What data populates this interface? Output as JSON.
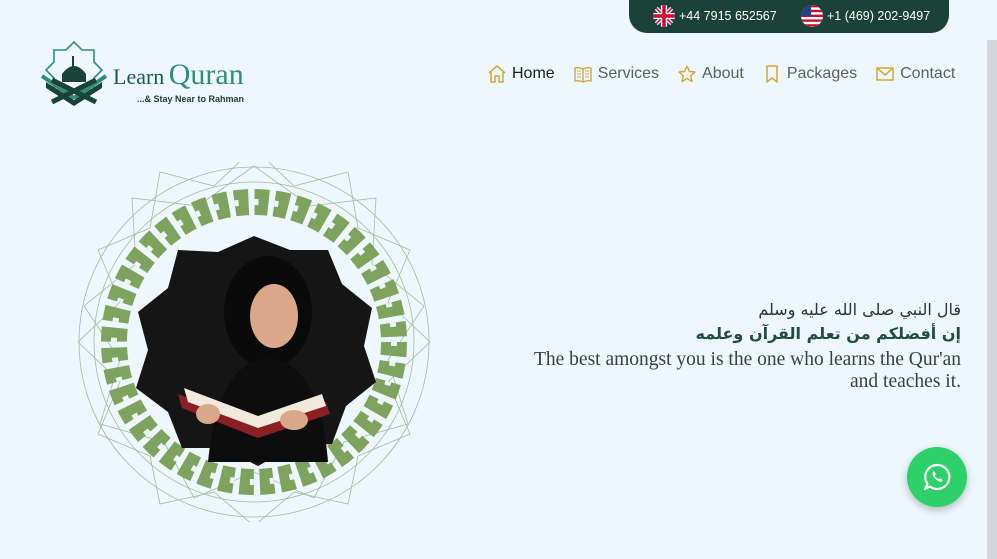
{
  "topbar": {
    "phone_uk": "+44 7915 652567",
    "phone_us": "+1 (469) 202-9497",
    "bg_color": "#1b4236"
  },
  "logo": {
    "word_learn": "Learn",
    "word_quran": "Quran",
    "tagline": "...& Stay Near to Rahman"
  },
  "nav": {
    "items": [
      {
        "label": "Home",
        "icon": "home-icon",
        "active": true
      },
      {
        "label": "Services",
        "icon": "book-icon"
      },
      {
        "label": "About",
        "icon": "star-icon"
      },
      {
        "label": "Packages",
        "icon": "bookmark-icon"
      },
      {
        "label": "Contact",
        "icon": "envelope-icon"
      }
    ],
    "icon_color": "#d4a73a"
  },
  "hero": {
    "quote_ar_line1": "قال النبي صلى الله عليه وسلم",
    "quote_ar_line2": "إن أفضلكم من تعلم القرآن وعلمه",
    "quote_en_line1": "The best amongst you is the one who learns the Qur'an",
    "quote_en_line2": "and teaches it."
  },
  "colors": {
    "page_bg": "#eef7fd",
    "brand_dark": "#1b4236",
    "pattern_green": "#7da35e",
    "whatsapp_green": "#2ed06a"
  },
  "floating": {
    "whatsapp_icon": "whatsapp-icon"
  }
}
